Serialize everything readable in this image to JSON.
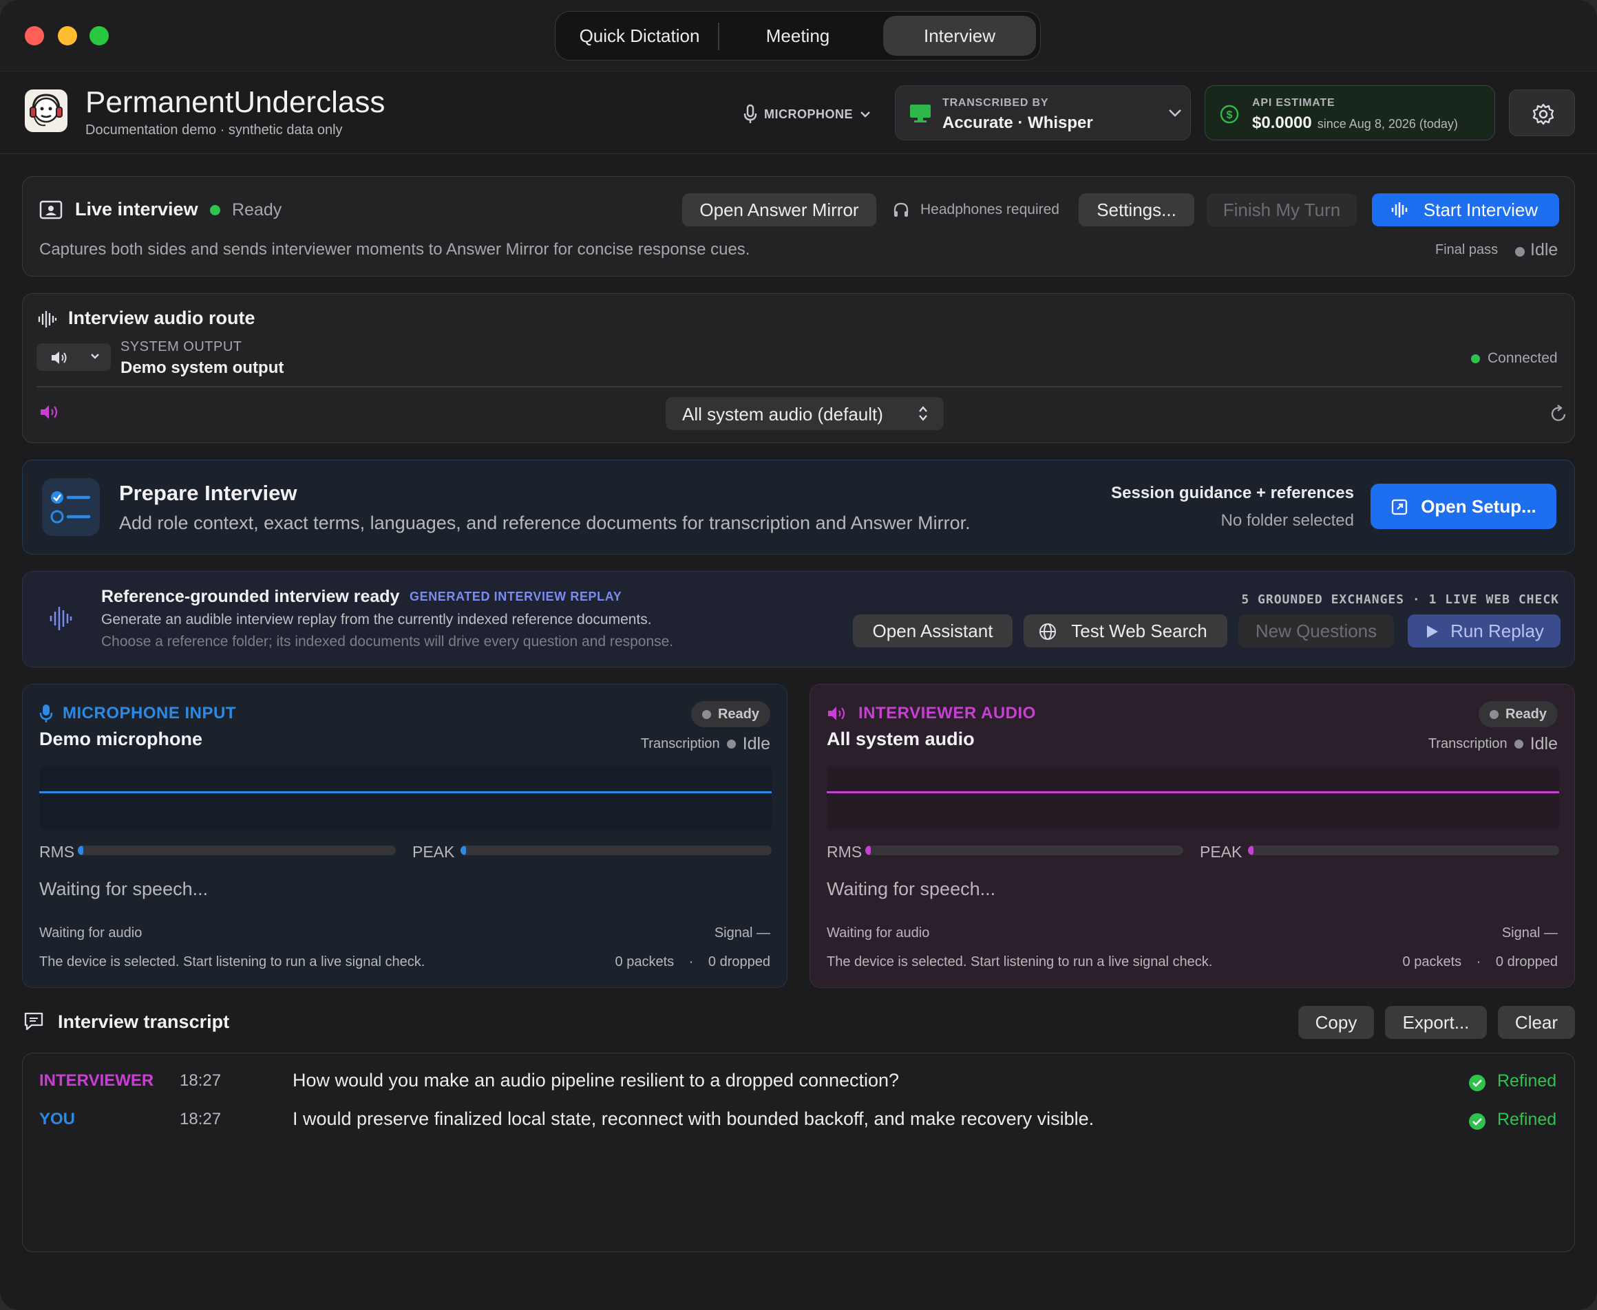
{
  "tabs": [
    "Quick Dictation",
    "Meeting",
    "Interview"
  ],
  "header": {
    "app_name": "PermanentUnderclass",
    "subtitle": "Documentation demo · synthetic data only",
    "mic_label": "MICROPHONE",
    "transcribed_by_label": "TRANSCRIBED BY",
    "transcribed_by_value": "Accurate · Whisper",
    "api_label": "API ESTIMATE",
    "api_value": "$0.0000",
    "api_since": "since Aug 8, 2026 (today)"
  },
  "live": {
    "title": "Live interview",
    "status": "Ready",
    "open_mirror": "Open Answer Mirror",
    "headphones": "Headphones required",
    "settings": "Settings...",
    "finish": "Finish My Turn",
    "start": "Start Interview",
    "description": "Captures both sides and sends interviewer moments to Answer Mirror for concise response cues.",
    "final_pass_label": "Final pass",
    "final_pass_state": "Idle"
  },
  "route": {
    "title": "Interview audio route",
    "output_label": "SYSTEM OUTPUT",
    "output_value": "Demo system output",
    "connected": "Connected",
    "source_select": "All system audio (default)"
  },
  "prepare": {
    "title": "Prepare Interview",
    "description": "Add role context, exact terms, languages, and reference documents for transcription and Answer Mirror.",
    "guidance": "Session guidance + references",
    "folder": "No folder selected",
    "open_setup": "Open Setup..."
  },
  "replay": {
    "title": "Reference-grounded interview ready",
    "tag": "GENERATED INTERVIEW REPLAY",
    "line1": "Generate an audible interview replay from the currently indexed reference documents.",
    "line2": "Choose a reference folder; its indexed documents will drive every question and response.",
    "stats": "5 GROUNDED EXCHANGES · 1 LIVE WEB CHECK",
    "open_assistant": "Open Assistant",
    "test_web": "Test Web Search",
    "new_questions": "New Questions",
    "run_replay": "Run Replay"
  },
  "mic_panel": {
    "title": "MICROPHONE INPUT",
    "device": "Demo microphone",
    "badge": "Ready",
    "transcription_label": "Transcription",
    "transcription_state": "Idle",
    "rms_label": "RMS",
    "peak_label": "PEAK",
    "rms_level": 0.01,
    "peak_level": 0.01,
    "waiting": "Waiting for speech...",
    "audio_status": "Waiting for audio",
    "signal": "Signal —",
    "hint": "The device is selected. Start listening to run a live signal check.",
    "packets": "0 packets",
    "sep": "·",
    "dropped": "0 dropped",
    "color": "#2b8ae6"
  },
  "int_panel": {
    "title": "INTERVIEWER AUDIO",
    "device": "All system audio",
    "badge": "Ready",
    "transcription_label": "Transcription",
    "transcription_state": "Idle",
    "rms_label": "RMS",
    "peak_label": "PEAK",
    "rms_level": 0.01,
    "peak_level": 0.01,
    "waiting": "Waiting for speech...",
    "audio_status": "Waiting for audio",
    "signal": "Signal —",
    "hint": "The device is selected. Start listening to run a live signal check.",
    "packets": "0 packets",
    "sep": "·",
    "dropped": "0 dropped",
    "color": "#c93fd4"
  },
  "transcript": {
    "title": "Interview transcript",
    "copy": "Copy",
    "export": "Export...",
    "clear": "Clear",
    "rows": [
      {
        "speaker": "INTERVIEWER",
        "time": "18:27",
        "text": "How would you make an audio pipeline resilient to a dropped connection?",
        "status": "Refined"
      },
      {
        "speaker": "YOU",
        "time": "18:27",
        "text": "I would preserve finalized local state, reconnect with bounded backoff, and make recovery visible.",
        "status": "Refined"
      }
    ]
  },
  "icons": [
    "headphones-icon",
    "gear-icon",
    "microphone-icon",
    "speaker-icon",
    "waveform-icon",
    "globe-icon",
    "play-icon",
    "checkmark-icon",
    "chat-icon",
    "refresh-icon",
    "external-link-icon",
    "checklist-icon"
  ]
}
